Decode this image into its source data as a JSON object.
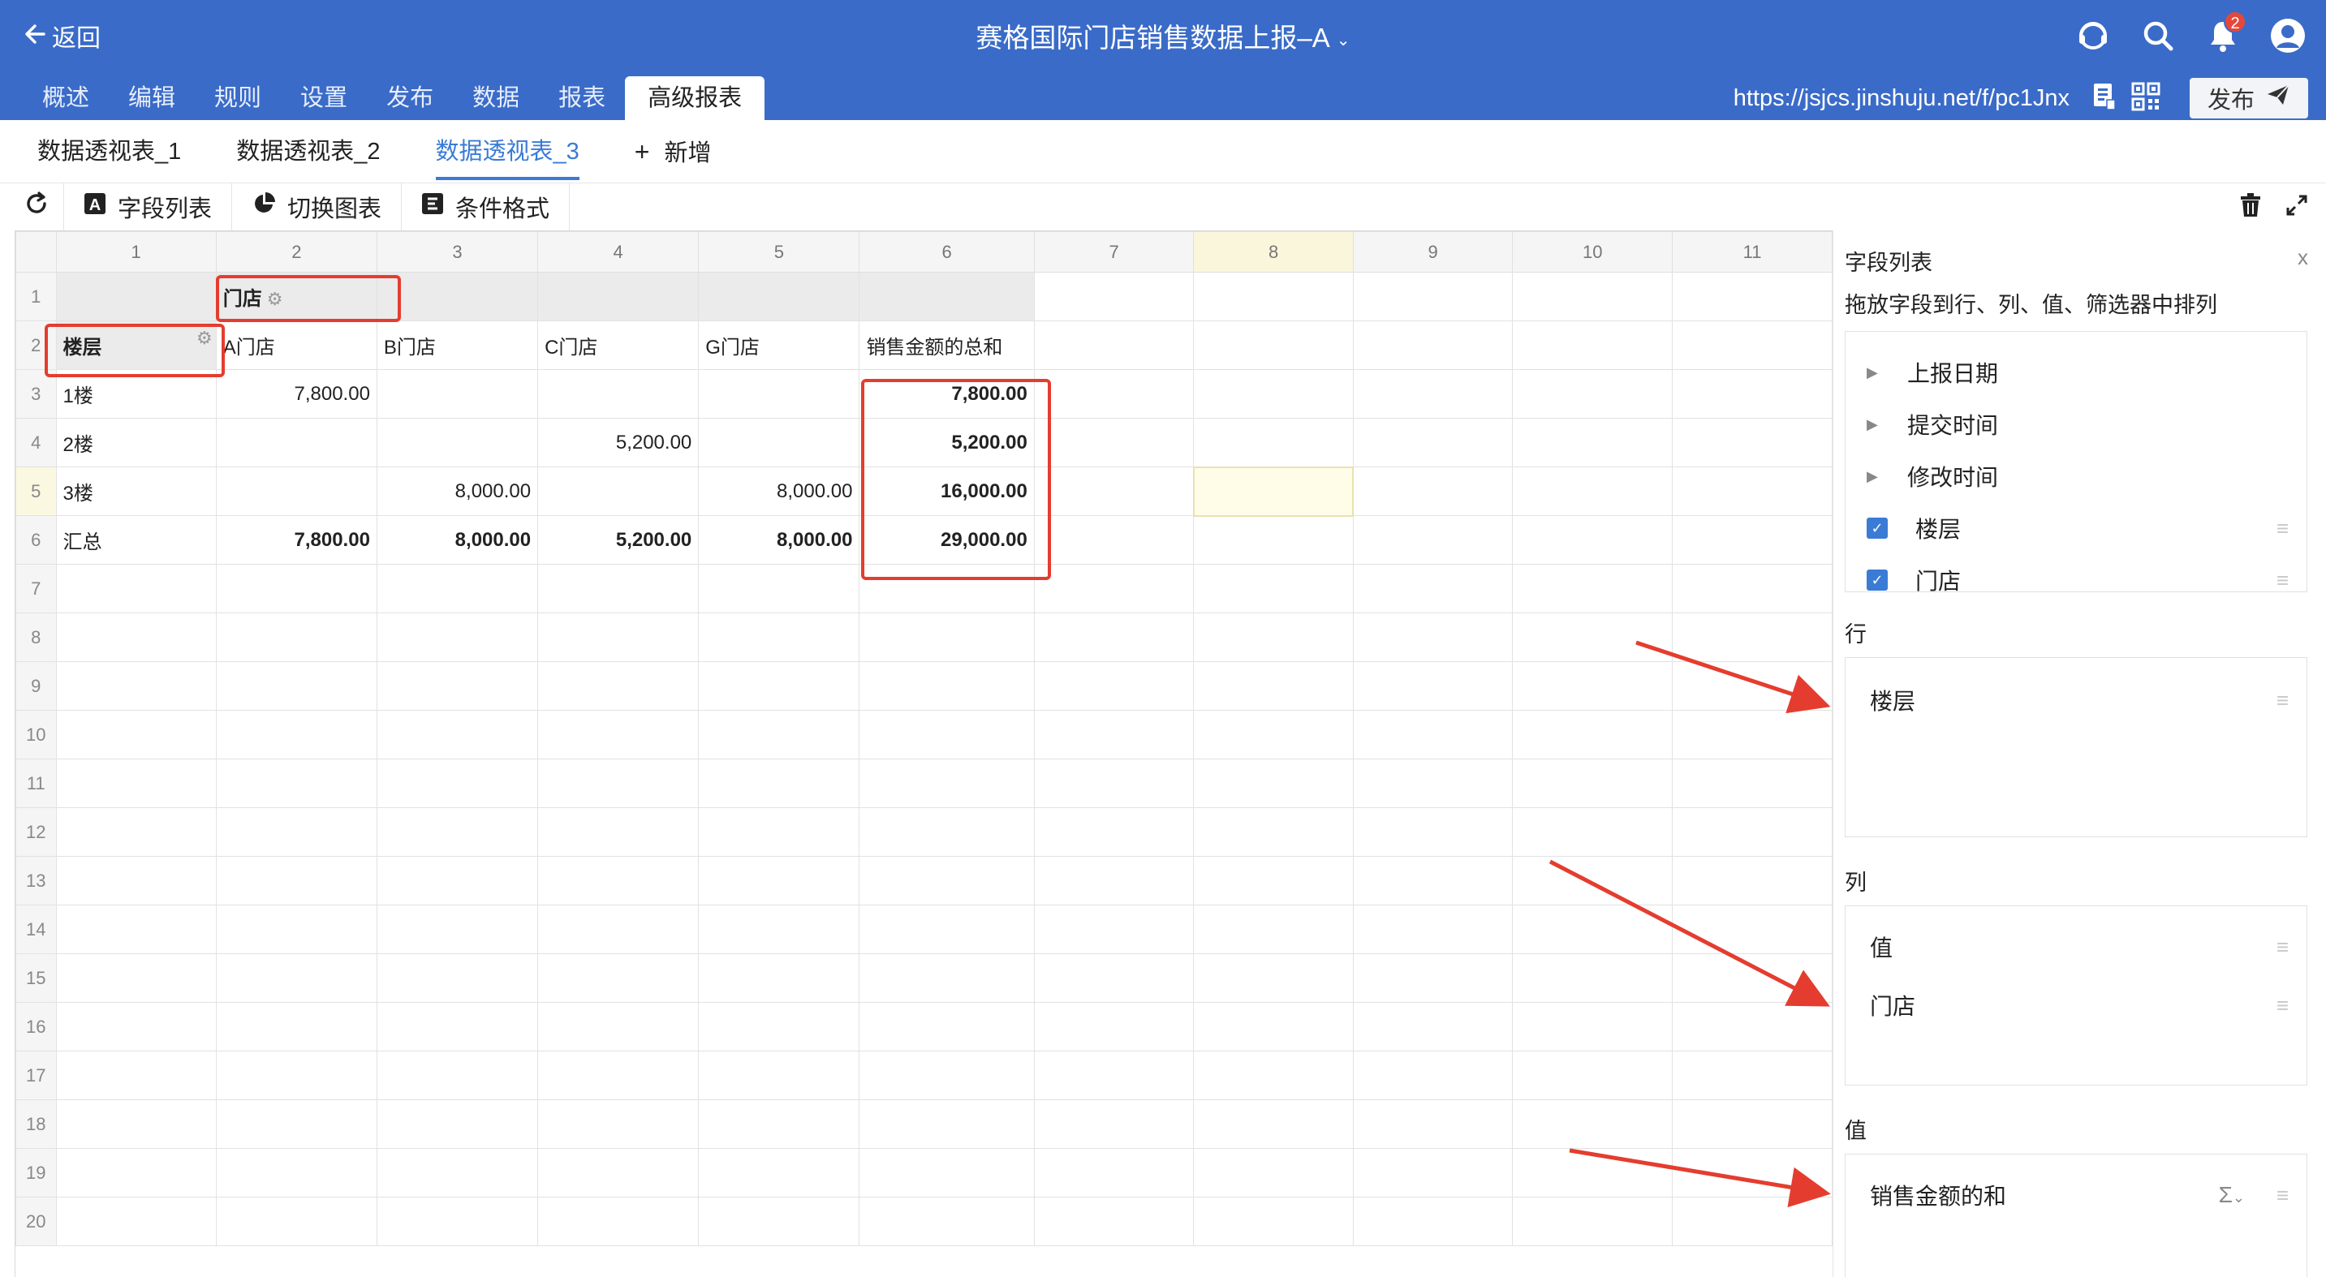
{
  "header": {
    "back_label": "返回",
    "title": "赛格国际门店销售数据上报–A",
    "notification_count": "2",
    "icons": [
      "support-icon",
      "search-icon",
      "bell-icon",
      "user-avatar-icon"
    ]
  },
  "nav": {
    "tabs": [
      "概述",
      "编辑",
      "规则",
      "设置",
      "发布",
      "数据",
      "报表",
      "高级报表"
    ],
    "active_index": 7,
    "url": "https://jsjcs.jinshuju.net/f/pc1Jnx",
    "publish_label": "发布"
  },
  "sheet_tabs": {
    "tabs": [
      "数据透视表_1",
      "数据透视表_2",
      "数据透视表_3"
    ],
    "active_index": 2,
    "add_label": "新增"
  },
  "toolbar": {
    "field_list_label": "字段列表",
    "switch_chart_label": "切换图表",
    "conditional_format_label": "条件格式"
  },
  "grid": {
    "column_headers": [
      "1",
      "2",
      "3",
      "4",
      "5",
      "6",
      "7",
      "8",
      "9",
      "10",
      "11"
    ],
    "row_numbers": [
      "1",
      "2",
      "3",
      "4",
      "5",
      "6",
      "7",
      "8",
      "9",
      "10",
      "11",
      "12",
      "13",
      "14",
      "15",
      "16",
      "17",
      "18",
      "19",
      "20"
    ],
    "selected_cell": {
      "row": "5",
      "col": "8"
    },
    "pivot": {
      "column_field": "门店",
      "row_field": "楼层",
      "store_headers": [
        "A门店",
        "B门店",
        "C门店",
        "G门店"
      ],
      "total_header": "销售金额的总和",
      "rows": [
        {
          "label": "1楼",
          "values": [
            "7,800.00",
            "",
            "",
            ""
          ],
          "total": "7,800.00"
        },
        {
          "label": "2楼",
          "values": [
            "",
            "",
            "5,200.00",
            ""
          ],
          "total": "5,200.00"
        },
        {
          "label": "3楼",
          "values": [
            "",
            "8,000.00",
            "",
            "8,000.00"
          ],
          "total": "16,000.00"
        },
        {
          "label": "汇总",
          "values": [
            "7,800.00",
            "8,000.00",
            "5,200.00",
            "8,000.00"
          ],
          "total": "29,000.00"
        }
      ]
    }
  },
  "panel": {
    "title": "字段列表",
    "close_label": "x",
    "hint": "拖放字段到行、列、值、筛选器中排列",
    "fields": [
      {
        "label": "上报日期",
        "type": "expand"
      },
      {
        "label": "提交时间",
        "type": "expand"
      },
      {
        "label": "修改时间",
        "type": "expand"
      },
      {
        "label": "楼层",
        "type": "checked"
      },
      {
        "label": "门店",
        "type": "checked"
      }
    ],
    "rows_label": "行",
    "rows_items": [
      "楼层"
    ],
    "columns_label": "列",
    "columns_items": [
      "值",
      "门店"
    ],
    "values_label": "值",
    "values_items": [
      "销售金额的和"
    ],
    "sigma_label": "Σ"
  },
  "colors": {
    "header_blue": "#3a6bc8",
    "accent_blue": "#3a7bd5",
    "highlight_red": "#e43d2f"
  }
}
